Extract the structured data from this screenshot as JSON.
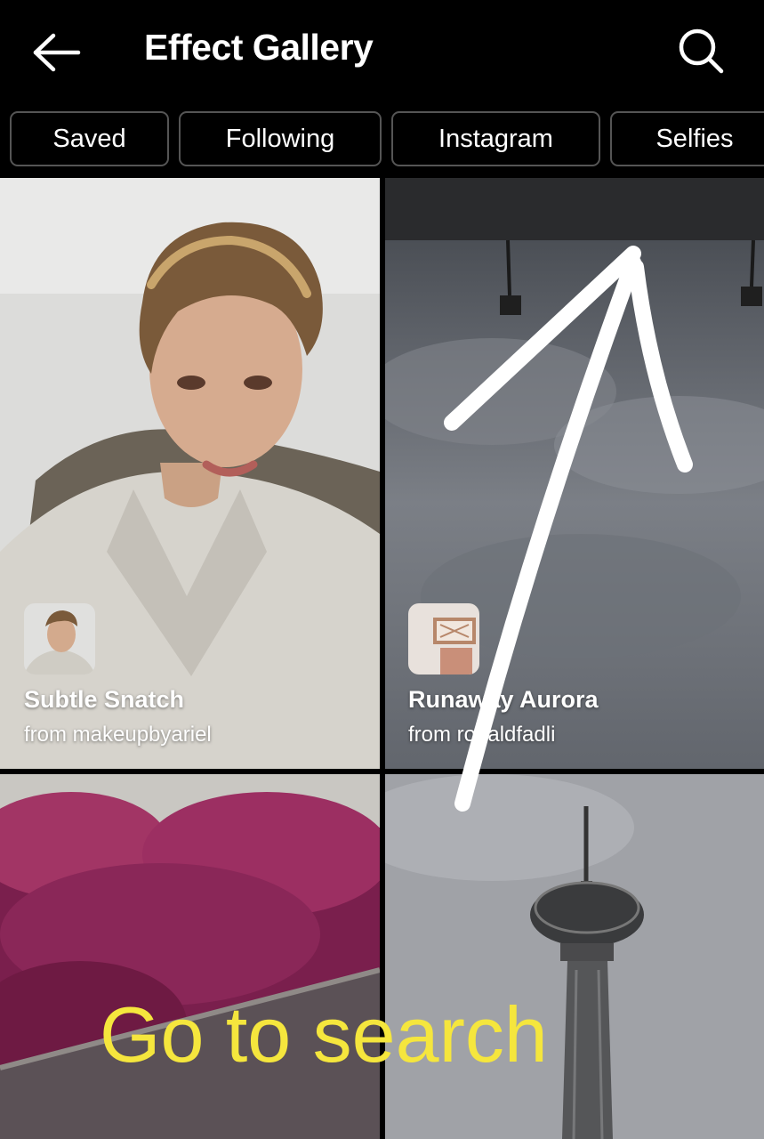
{
  "header": {
    "title": "Effect Gallery",
    "back_icon": "arrow-left-icon",
    "search_icon": "search-icon"
  },
  "tabs": [
    {
      "label": "Saved"
    },
    {
      "label": "Following"
    },
    {
      "label": "Instagram"
    },
    {
      "label": "Selfies"
    }
  ],
  "effects": [
    {
      "name": "Subtle Snatch",
      "author": "from makeupbyariel"
    },
    {
      "name": "Runaway Aurora",
      "author": "from ronaldfadli"
    }
  ],
  "annotation": {
    "text": "Go to search",
    "color": "#f5e63d",
    "arrow_color": "#ffffff"
  }
}
